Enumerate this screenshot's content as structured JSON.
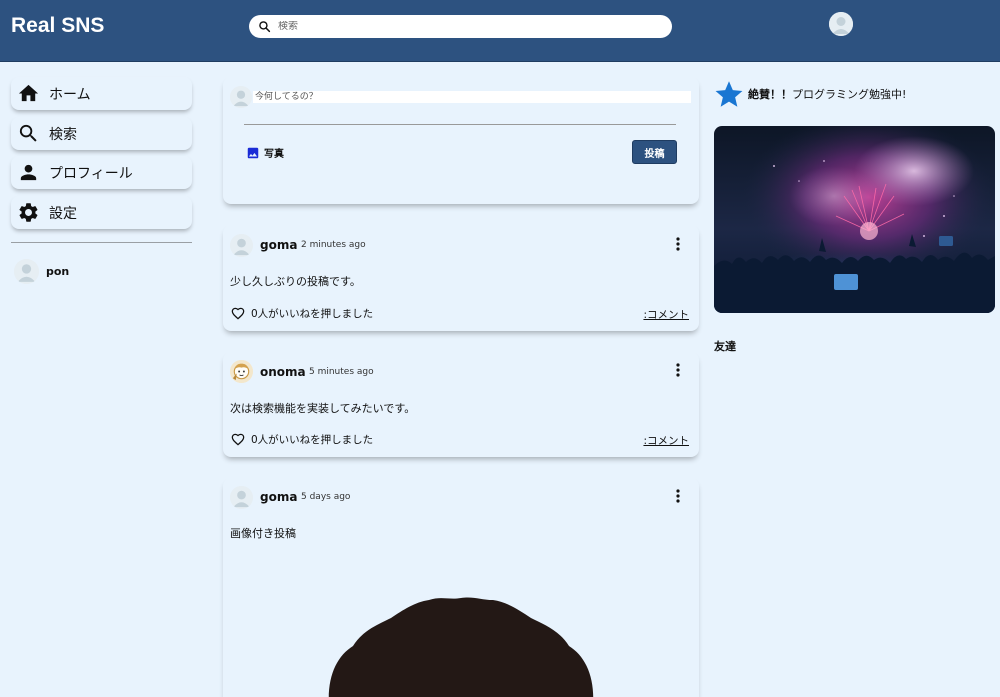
{
  "header": {
    "logo": "Real SNS",
    "search_placeholder": "検索"
  },
  "sidebar": {
    "items": [
      {
        "label": "ホーム",
        "icon": "home-icon"
      },
      {
        "label": "検索",
        "icon": "search-icon"
      },
      {
        "label": "プロフィール",
        "icon": "person-icon"
      },
      {
        "label": "設定",
        "icon": "gear-icon"
      }
    ],
    "friends": [
      {
        "name": "pon"
      }
    ]
  },
  "share": {
    "placeholder": "今何してるの？",
    "photo_label": "写真",
    "post_button": "投稿"
  },
  "posts": [
    {
      "user": "goma",
      "time": "2 minutes ago",
      "text": "少し久しぶりの投稿です。",
      "likes": "0人がいいねを押しました",
      "comment": ":コメント"
    },
    {
      "user": "onoma",
      "time": "5 minutes ago",
      "text": "次は検索機能を実装してみたいです。",
      "likes": "0人がいいねを押しました",
      "comment": ":コメント"
    },
    {
      "user": "goma",
      "time": "5 days ago",
      "text": "画像付き投稿"
    }
  ],
  "rightbar": {
    "event_bold": "絶賛！！",
    "event_text": "プログラミング勉強中!",
    "friends_title": "友達"
  },
  "colors": {
    "header": "#2d5280",
    "background": "#e8f3fd",
    "star": "#1976d2"
  }
}
